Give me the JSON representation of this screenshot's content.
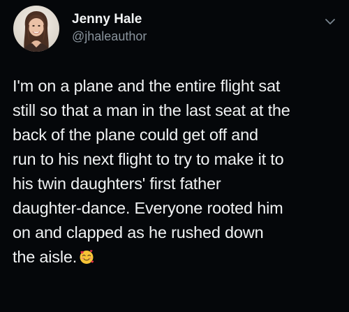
{
  "tweet": {
    "author": {
      "name": "Jenny Hale",
      "handle": "@jhaleauthor",
      "avatar_icon": "profile-photo"
    },
    "menu_icon": "chevron-down-icon",
    "text_lines": [
      "I'm on a plane and the entire flight sat",
      "still so that a man in the last seat at the",
      "back of the plane could get off and",
      "run to his next flight to try to make it to",
      "his twin daughters' first father",
      "daughter-dance. Everyone rooted him",
      "on and clapped as he rushed down",
      "the aisle."
    ],
    "emoji": "smiling-face-with-hearts",
    "colors": {
      "background": "#05070a",
      "text": "#f0f2f3",
      "handle": "#8a949d"
    }
  }
}
